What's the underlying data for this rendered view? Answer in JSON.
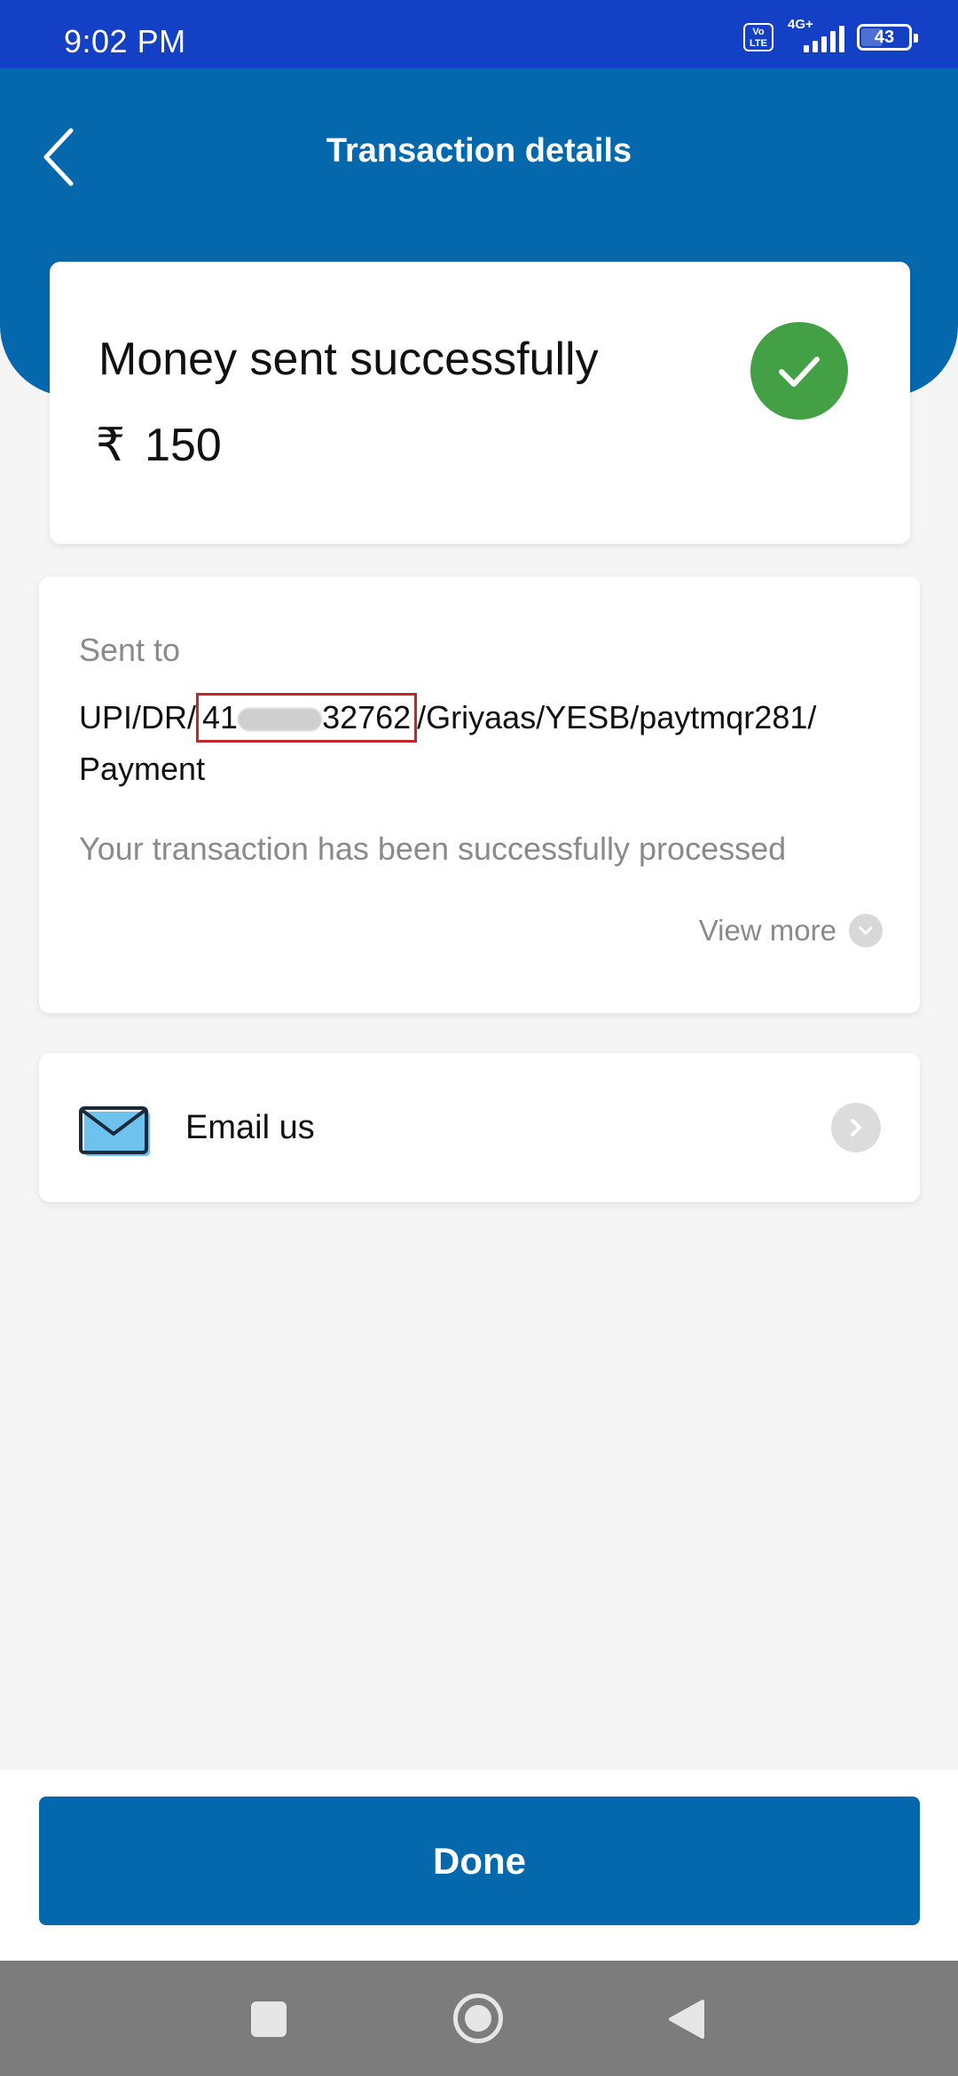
{
  "status_bar": {
    "time": "9:02 PM",
    "volte_label": "Vo\nLTE",
    "network_label": "4G+",
    "battery_level": "43"
  },
  "header": {
    "title": "Transaction details",
    "back_icon": "chevron-left-icon"
  },
  "summary": {
    "status_text": "Money sent successfully",
    "currency_symbol": "₹",
    "amount": "150",
    "status_icon": "check-circle-icon",
    "status_color": "#44a044"
  },
  "details": {
    "sent_to_label": "Sent to",
    "upi_prefix": "UPI/DR/",
    "upi_ref_start": "41",
    "upi_ref_end": "32762",
    "upi_suffix": "/Griyaas/YESB/paytmqr281/",
    "upi_line2": "Payment",
    "message": "Your transaction has been successfully processed",
    "view_more_label": "View more"
  },
  "support": {
    "email_label": "Email us",
    "email_icon": "envelope-icon"
  },
  "actions": {
    "done_label": "Done"
  },
  "theme": {
    "primary": "#0568ad",
    "status_bar": "#1340c4",
    "highlight_border": "#c4262c"
  }
}
